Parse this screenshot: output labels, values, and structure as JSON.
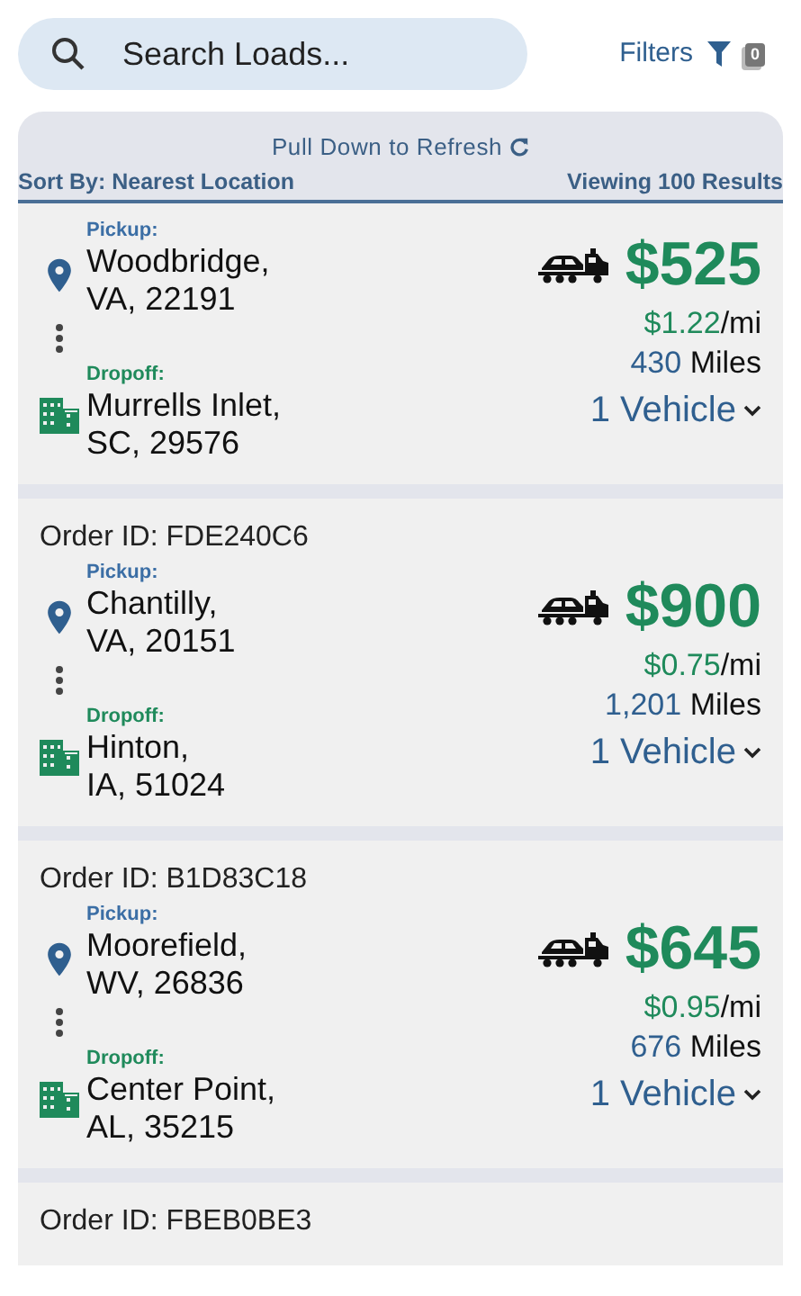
{
  "search": {
    "placeholder": "Search Loads..."
  },
  "filters": {
    "label": "Filters",
    "count": "0"
  },
  "list_header": {
    "refresh_hint": "Pull Down to Refresh",
    "sort": "Sort By: Nearest Location",
    "results": "Viewing 100 Results"
  },
  "loads": [
    {
      "pickup_label": "Pickup:",
      "pickup_lines": [
        "Woodbridge,",
        "VA, 22191"
      ],
      "dropoff_label": "Dropoff:",
      "dropoff_lines": [
        "Murrells Inlet,",
        "SC, 29576"
      ],
      "price": "$525",
      "rate": "$1.22",
      "rate_unit": "/mi",
      "miles": "430",
      "miles_unit": "Miles",
      "vehicles": "1 Vehicle"
    },
    {
      "order_id": "Order ID: FDE240C6",
      "pickup_label": "Pickup:",
      "pickup_lines": [
        "Chantilly,",
        "VA, 20151"
      ],
      "dropoff_label": "Dropoff:",
      "dropoff_lines": [
        "Hinton,",
        "IA, 51024"
      ],
      "price": "$900",
      "rate": "$0.75",
      "rate_unit": "/mi",
      "miles": "1,201",
      "miles_unit": "Miles",
      "vehicles": "1 Vehicle"
    },
    {
      "order_id": "Order ID: B1D83C18",
      "pickup_label": "Pickup:",
      "pickup_lines": [
        "Moorefield,",
        "WV, 26836"
      ],
      "dropoff_label": "Dropoff:",
      "dropoff_lines": [
        "Center Point,",
        "AL, 35215"
      ],
      "price": "$645",
      "rate": "$0.95",
      "rate_unit": "/mi",
      "miles": "676",
      "miles_unit": "Miles",
      "vehicles": "1 Vehicle"
    },
    {
      "order_id": "Order ID: FBEB0BE3"
    }
  ]
}
